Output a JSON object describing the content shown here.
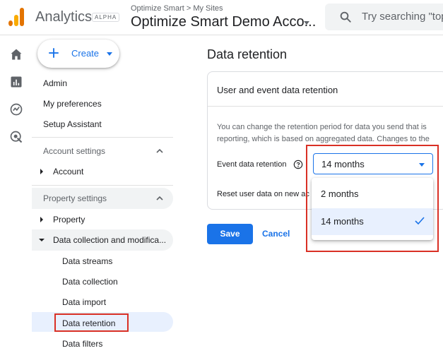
{
  "header": {
    "app_title": "Analytics",
    "alpha_badge": "ALPHA",
    "breadcrumb": "Optimize Smart > My Sites",
    "account_name": "Optimize Smart Demo Acco...",
    "search_placeholder": "Try searching \"top"
  },
  "rail": {
    "icons": [
      "home-icon",
      "reports-icon",
      "explore-icon",
      "advertising-icon"
    ]
  },
  "sidebar": {
    "create_label": "Create",
    "admin": "Admin",
    "my_preferences": "My preferences",
    "setup_assistant": "Setup Assistant",
    "account_settings": "Account settings",
    "account": "Account",
    "property_settings": "Property settings",
    "property": "Property",
    "data_collection_mod": "Data collection and modifica...",
    "sub_items": [
      "Data streams",
      "Data collection",
      "Data import",
      "Data retention",
      "Data filters"
    ]
  },
  "main": {
    "page_title": "Data retention",
    "card_title": "User and event data retention",
    "desc_line1": "You can change the retention period for data you send that is",
    "desc_line2": "reporting, which is based on aggregated data. Changes to the",
    "event_retention_label": "Event data retention",
    "reset_label": "Reset user data on new ac",
    "select_value": "14 months",
    "options": [
      "2 months",
      "14 months"
    ],
    "selected_option": "14 months",
    "save_label": "Save",
    "cancel_label": "Cancel"
  },
  "colors": {
    "accent": "#1a73e8",
    "annotation_red": "#d93025",
    "logo_orange": "#f9ab00",
    "logo_dark_orange": "#e37400"
  }
}
